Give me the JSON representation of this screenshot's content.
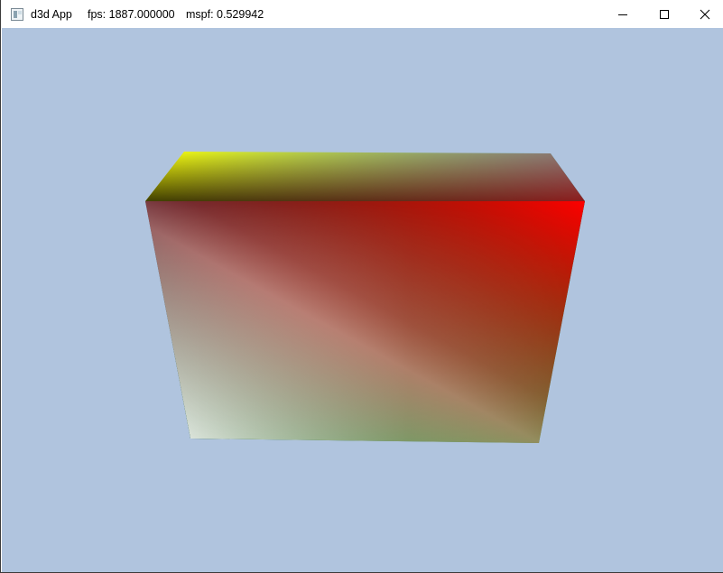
{
  "window": {
    "app_title": "d3d App",
    "fps_text": "fps: 1887.000000",
    "mspf_text": "mspf: 0.529942",
    "icons": {
      "app": "app-window-icon",
      "minimize": "minimize-icon",
      "maximize": "maximize-icon",
      "close": "close-icon"
    }
  },
  "scene": {
    "background_color": "#b0c4de",
    "object": "colored-cube",
    "face_colors": {
      "top_back_left": "#ffff00",
      "top_back_right": "#00ffff",
      "front_top_left": "#000000",
      "front_top_right": "#ff0000",
      "front_bottom_left": "#ffffff",
      "front_bottom_right": "#008000"
    }
  }
}
